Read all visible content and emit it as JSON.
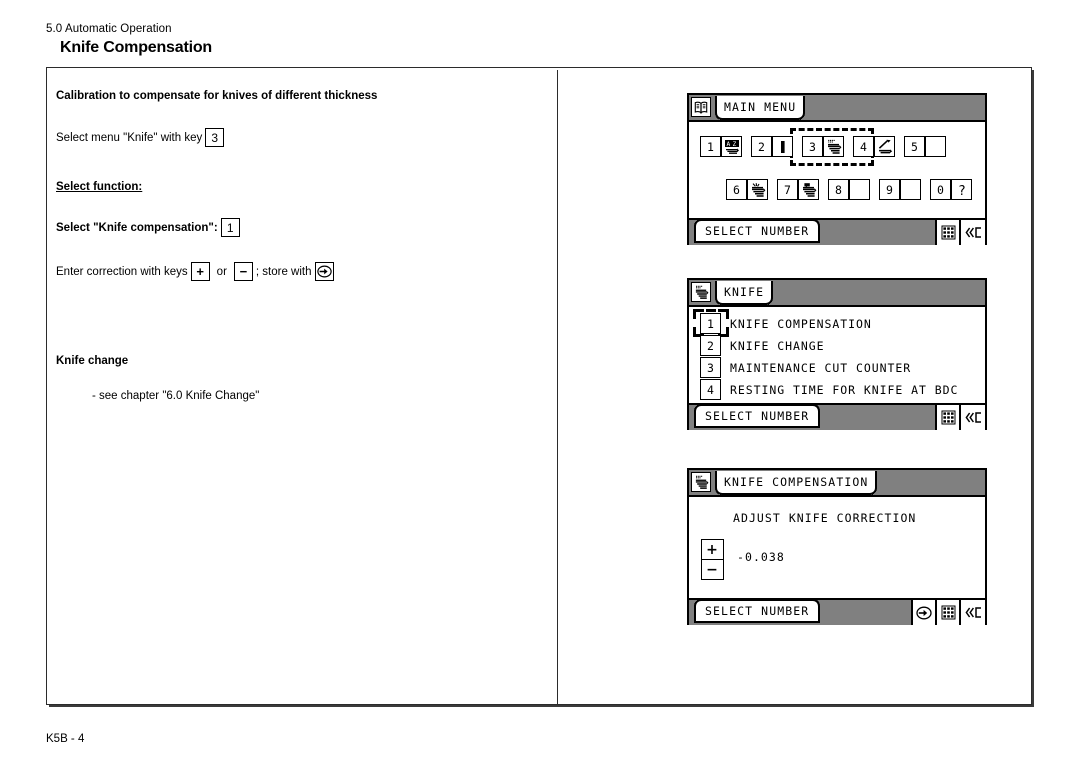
{
  "header": {
    "chapter": "5.0 Automatic Operation",
    "title": "Knife Compensation"
  },
  "instructions": {
    "heading": "Calibration to compensate for knives of different thickness",
    "select_menu_prefix": "Select menu \"Knife\" with key",
    "select_menu_key": "3",
    "select_function_heading": "Select function:",
    "select_knife_comp_prefix": "Select \"Knife compensation\":",
    "select_knife_comp_key": "1",
    "enter_correction_prefix": "Enter correction with keys",
    "enter_correction_plus": "+",
    "enter_correction_or": "or",
    "enter_correction_minus": "−",
    "enter_correction_suffix": "; store with",
    "enter_correction_store_icon": "enter-store-icon",
    "knife_change_heading": "Knife change",
    "knife_change_note": "- see chapter \"6.0 Knife Change\""
  },
  "panels": {
    "main_menu": {
      "title_icon": "book-icon",
      "title": "MAIN MENU",
      "status": "SELECT NUMBER",
      "status_icons": [
        "keypad-icon",
        "back-clear-icon"
      ],
      "row1": [
        {
          "num": "1",
          "icon": "az-sort-icon"
        },
        {
          "num": "2",
          "icon": "bar-icon"
        },
        {
          "num": "3",
          "icon": "knife-icon"
        },
        {
          "num": "4",
          "icon": "wrench-icon"
        },
        {
          "num": "5",
          "icon": "blank-icon"
        }
      ],
      "row2": [
        {
          "num": "6",
          "icon": "hand-stack-icon"
        },
        {
          "num": "7",
          "icon": "clamp-stack-icon"
        },
        {
          "num": "8",
          "icon": "blank-icon"
        },
        {
          "num": "9",
          "icon": "blank-icon"
        },
        {
          "num": "0",
          "icon": "question-icon"
        }
      ],
      "focused_item": "3"
    },
    "knife": {
      "title_icon": "knife-icon",
      "title": "KNIFE",
      "status": "SELECT NUMBER",
      "status_icons": [
        "keypad-icon",
        "back-clear-icon"
      ],
      "items": [
        {
          "num": "1",
          "label": "KNIFE COMPENSATION"
        },
        {
          "num": "2",
          "label": "KNIFE CHANGE"
        },
        {
          "num": "3",
          "label": "MAINTENANCE CUT COUNTER"
        },
        {
          "num": "4",
          "label": "RESTING TIME FOR KNIFE AT BDC"
        }
      ],
      "focused_item": "1"
    },
    "knife_compensation": {
      "title_icon": "knife-icon",
      "title": "KNIFE COMPENSATION",
      "caption": "ADJUST KNIFE CORRECTION",
      "plus_label": "+",
      "minus_label": "−",
      "value": "-0.038",
      "status": "SELECT NUMBER",
      "status_icons": [
        "enter-store-icon",
        "keypad-icon",
        "back-clear-icon"
      ]
    }
  },
  "footer": {
    "page_ref": "K5B - 4"
  },
  "colors": {
    "ink": "#000000",
    "frame": "#2b2b2b",
    "paper": "#ffffff"
  }
}
